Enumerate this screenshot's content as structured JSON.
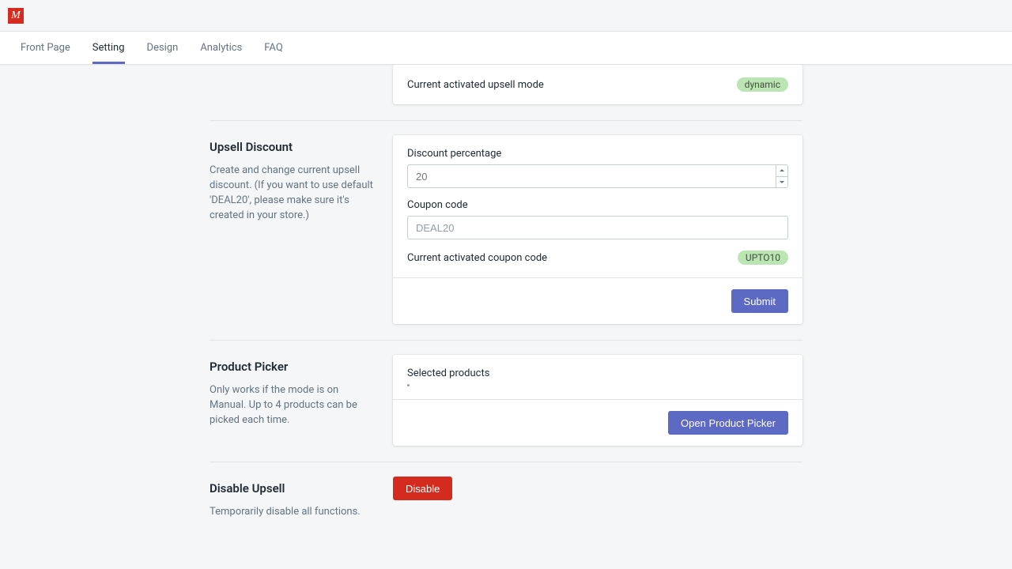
{
  "logo_glyph": "M",
  "tabs": {
    "front_page": "Front Page",
    "setting": "Setting",
    "design": "Design",
    "analytics": "Analytics",
    "faq": "FAQ"
  },
  "upsell_mode": {
    "status_label": "Current activated upsell mode",
    "status_value": "dynamic"
  },
  "upsell_discount": {
    "title": "Upsell Discount",
    "description": "Create and change current upsell discount. (If you want to use default 'DEAL20', please make sure it's created in your store.)",
    "percentage_label": "Discount percentage",
    "percentage_placeholder": "20",
    "coupon_label": "Coupon code",
    "coupon_placeholder": "DEAL20",
    "status_label": "Current activated coupon code",
    "status_value": "UPTO10",
    "submit_label": "Submit"
  },
  "product_picker": {
    "title": "Product Picker",
    "description": "Only works if the mode is on Manual. Up to 4 products can be picked each time.",
    "selected_label": "Selected products",
    "open_label": "Open Product Picker"
  },
  "disable_upsell": {
    "title": "Disable Upsell",
    "description": "Temporarily disable all functions.",
    "button_label": "Disable"
  }
}
